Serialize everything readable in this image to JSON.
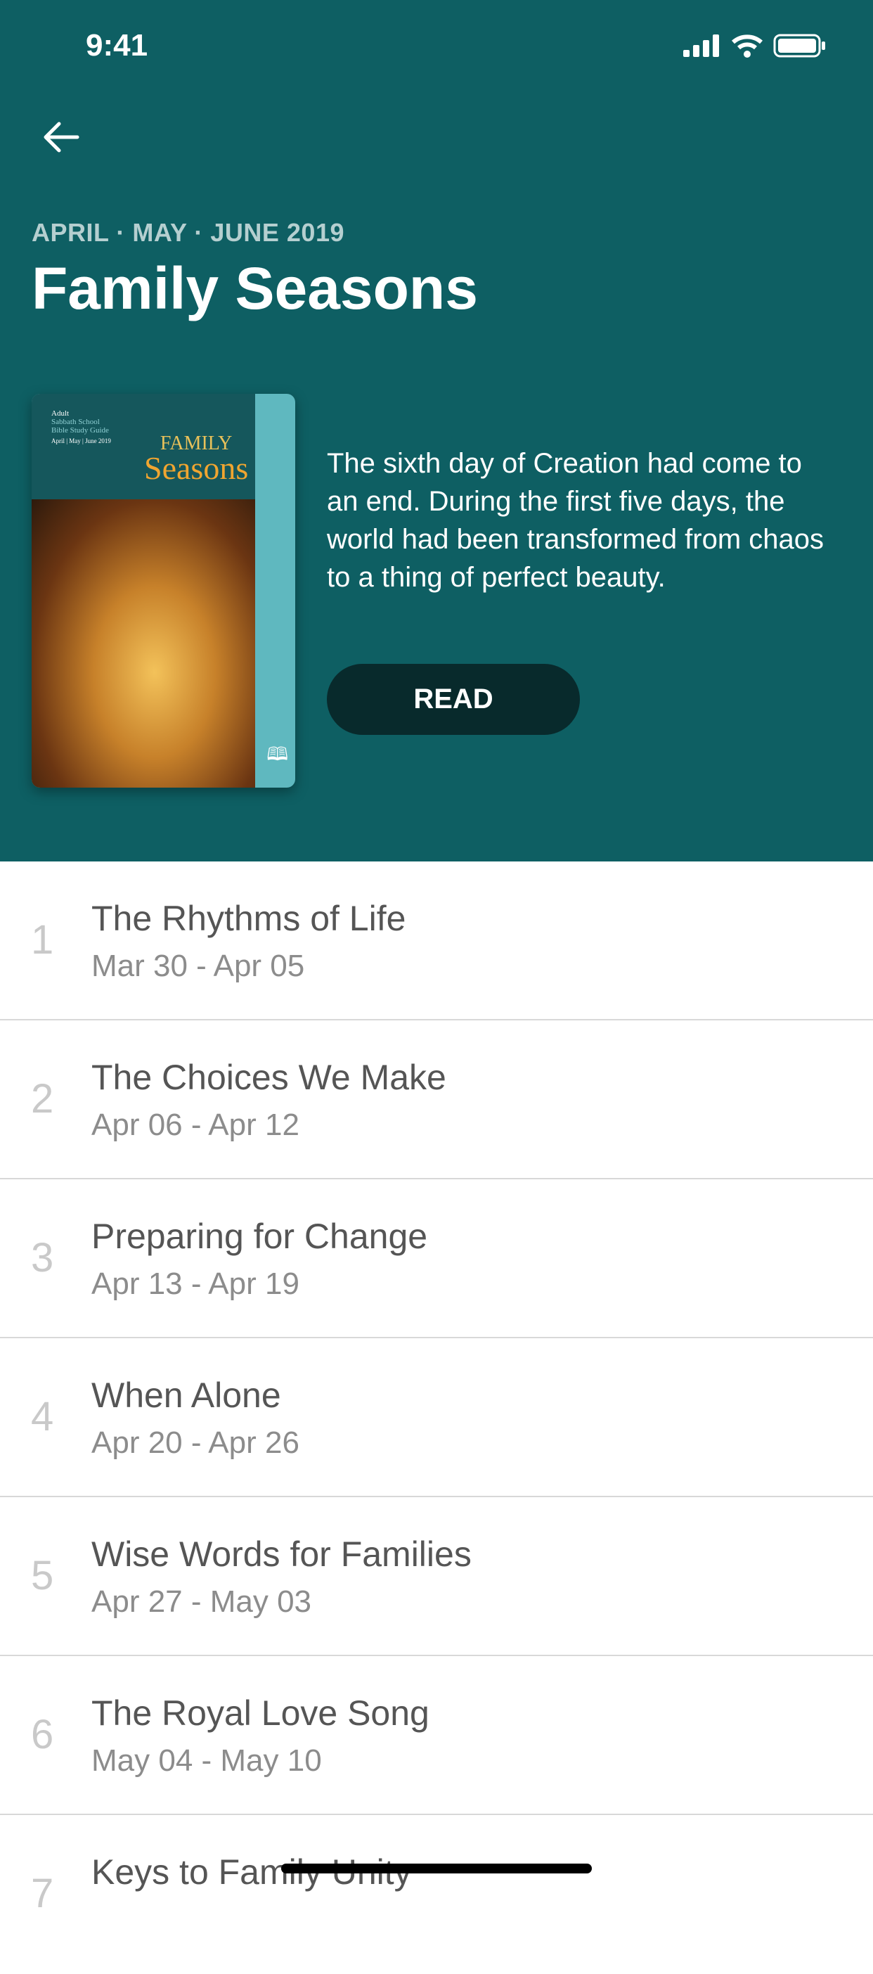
{
  "status": {
    "time": "9:41"
  },
  "header": {
    "quarter": "APRIL · MAY · JUNE 2019",
    "title": "Family Seasons",
    "description": "The sixth day of Creation had come to an end. During the first five days, the world had been transformed from chaos to a thing of perfect beauty.",
    "read_label": "READ",
    "bg_color": "#0e5f63"
  },
  "cover": {
    "line1": "Adult",
    "line2": "Sabbath School",
    "line3": "Bible Study Guide",
    "dates": "April | May | June 2019",
    "title1": "FAMILY",
    "title2": "Seasons"
  },
  "lessons": [
    {
      "num": "1",
      "title": "The Rhythms of Life",
      "dates": "Mar 30 - Apr 05"
    },
    {
      "num": "2",
      "title": "The Choices We Make",
      "dates": "Apr 06 - Apr 12"
    },
    {
      "num": "3",
      "title": "Preparing for Change",
      "dates": "Apr 13 - Apr 19"
    },
    {
      "num": "4",
      "title": "When Alone",
      "dates": "Apr 20 - Apr 26"
    },
    {
      "num": "5",
      "title": "Wise Words for Families",
      "dates": "Apr 27 - May 03"
    },
    {
      "num": "6",
      "title": "The Royal Love Song",
      "dates": "May 04 - May 10"
    },
    {
      "num": "7",
      "title": "Keys to Family Unity",
      "dates": ""
    }
  ]
}
